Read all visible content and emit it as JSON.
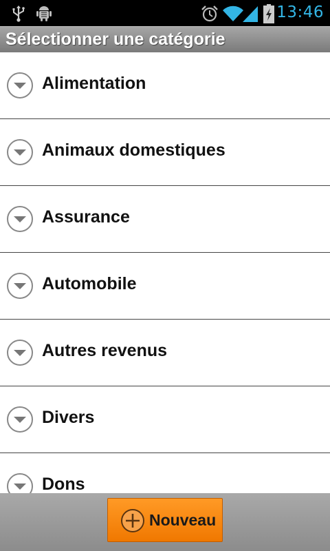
{
  "status_bar": {
    "time": "13:46",
    "icons": [
      "usb-icon",
      "android-debug-icon",
      "alarm-icon",
      "wifi-icon",
      "signal-icon",
      "battery-charging-icon"
    ],
    "accent_color": "#33b5e5"
  },
  "header": {
    "title": "Sélectionner une catégorie"
  },
  "categories": [
    {
      "label": "Alimentation"
    },
    {
      "label": "Animaux domestiques"
    },
    {
      "label": "Assurance"
    },
    {
      "label": "Automobile"
    },
    {
      "label": "Autres revenus"
    },
    {
      "label": "Divers"
    },
    {
      "label": "Dons"
    }
  ],
  "footer": {
    "new_button_label": "Nouveau",
    "new_button_icon": "add-circle-icon",
    "new_button_color": "#f58400"
  }
}
